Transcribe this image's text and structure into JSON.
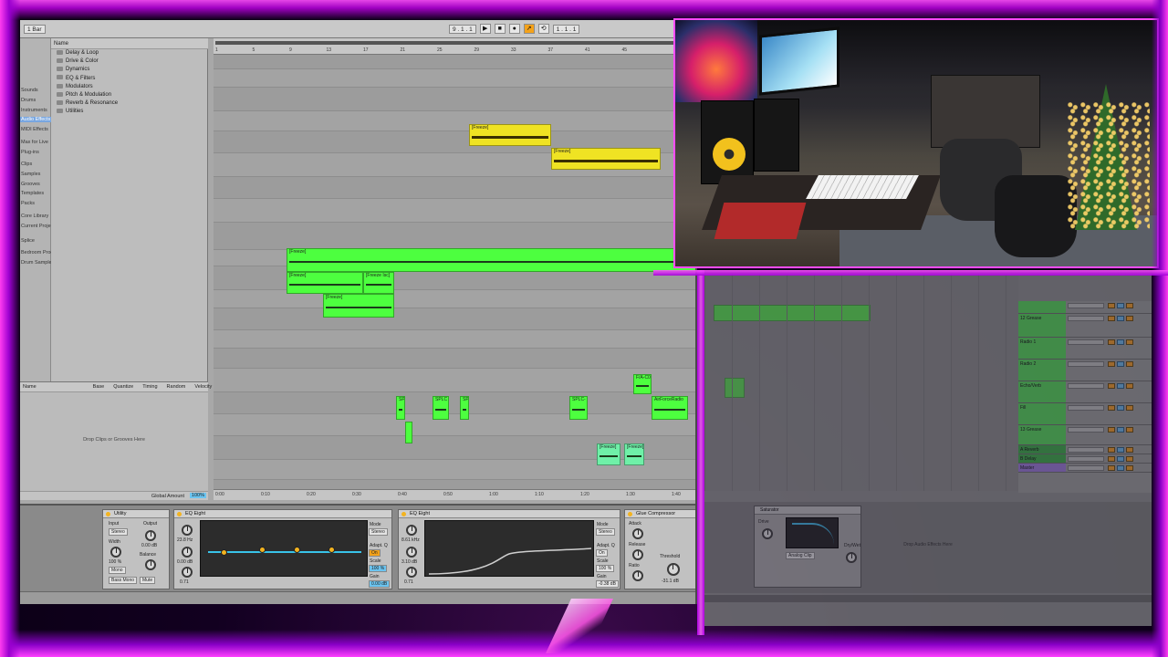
{
  "transport": {
    "left_fields": [
      "1 Bar"
    ],
    "position": "9 . 1 . 1",
    "end_position": "1 . 1 . 1"
  },
  "browser": {
    "header": "Name",
    "places": [
      "Sounds",
      "Drums",
      "Instruments",
      "Audio Effects",
      "MIDI Effects",
      "Max for Live",
      "Plug-ins",
      "Clips",
      "Samples",
      "Grooves",
      "Templates",
      "Packs",
      "Core Library",
      "Current Project",
      "Splice",
      "Bedroom Producer",
      "Drum Samples"
    ],
    "selected_place": "Audio Effects",
    "folders": [
      "Delay & Loop",
      "Drive & Color",
      "Dynamics",
      "EQ & Filters",
      "Modulators",
      "Pitch & Modulation",
      "Reverb & Resonance",
      "Utilities"
    ]
  },
  "groove_pool": {
    "columns": [
      "Name",
      "Base",
      "Quantize",
      "Timing",
      "Random",
      "Velocity"
    ],
    "drop_hint": "Drop Clips or Grooves Here",
    "global_amount_label": "Global Amount",
    "global_amount_value": "100%"
  },
  "arrangement": {
    "ruler_ticks": [
      "1",
      "5",
      "9",
      "13",
      "17",
      "21",
      "25",
      "29",
      "33",
      "37",
      "41",
      "45"
    ],
    "time_ticks": [
      "0:00",
      "0:10",
      "0:20",
      "0:30",
      "0:40",
      "0:50",
      "1:00",
      "1:10",
      "1:20",
      "1:30",
      "1:40"
    ],
    "clips": [
      {
        "label": "[Freeze]",
        "color": "#efe323"
      },
      {
        "label": "[Freeze]",
        "color": "#efe323"
      },
      {
        "label": "[Freeze]",
        "color": "#4dff3f"
      },
      {
        "label": "[Freeze]",
        "color": "#4dff3f"
      },
      {
        "label": "[Freeze Isc]",
        "color": "#4dff3f"
      },
      {
        "label": "[Freeze]",
        "color": "#4dff3f"
      },
      {
        "label": "SPL",
        "color": "#4dff3f"
      },
      {
        "label": "SPLC",
        "color": "#4dff3f"
      },
      {
        "label": "SPL",
        "color": "#4dff3f"
      },
      {
        "label": "SPLC-",
        "color": "#4dff3f"
      },
      {
        "label": "F/A-C0",
        "color": "#4dff3f"
      },
      {
        "label": "AirForceRadio",
        "color": "#4dff3f"
      },
      {
        "label": "[Freeze]",
        "color": "#6ff0a8"
      },
      {
        "label": "[Freeze]",
        "color": "#6ff0a8"
      }
    ]
  },
  "devices": {
    "utility": {
      "title": "Utility",
      "input": "Input",
      "output": "Output",
      "gain": "0.00 dB",
      "width": "Width",
      "width_val": "100 %",
      "mono": "Mono",
      "bass_mono": "Bass Mono",
      "balance": "Balance",
      "mute": "Mute",
      "stereo": "Stereo"
    },
    "eq1": {
      "title": "EQ Eight",
      "freq": "23.8 Hz",
      "gain": "0.00 dB",
      "q": "0.71",
      "mode": "Mode",
      "stereo": "Stereo",
      "adapt_q": "Adapt. Q",
      "on": "On",
      "scale": "Scale",
      "scale_val": "100 %",
      "gain_out": "Gain",
      "gain_out_val": "0.00 dB"
    },
    "eq2": {
      "title": "EQ Eight",
      "freq": "8.61 kHz",
      "gain": "3.10 dB",
      "q": "0.71",
      "mode": "Mode",
      "stereo": "Stereo",
      "adapt_q": "Adapt. Q",
      "on": "On",
      "scale": "Scale",
      "scale_val": "100 %",
      "gain_out": "Gain",
      "gain_out_val": "-0.38 dB"
    },
    "glue": {
      "title": "Glue Compressor",
      "attack": "Attack",
      "release": "Release",
      "ratio": "Ratio",
      "threshold": "Threshold",
      "threshold_val": "-31.1 dB"
    }
  },
  "second_set": {
    "tracks": [
      "",
      "12 Grease",
      "Radio 1",
      "Radio 2",
      "Echo/Verb",
      "Fill",
      "13 Grease",
      "A Reverb",
      "B Delay",
      "Master"
    ],
    "device_title": "Saturator",
    "drop_hint": "Drop Audio Effects Here",
    "drive": "Drive",
    "dry_wet": "Dry/Wet",
    "curve_type": "Analog Clip"
  },
  "colors": {
    "neon": "#ff4dff",
    "clip_yellow": "#efe323",
    "clip_green": "#4dff3f",
    "eq_curve": "#39c3e8",
    "accent_orange": "#f4a21a"
  }
}
